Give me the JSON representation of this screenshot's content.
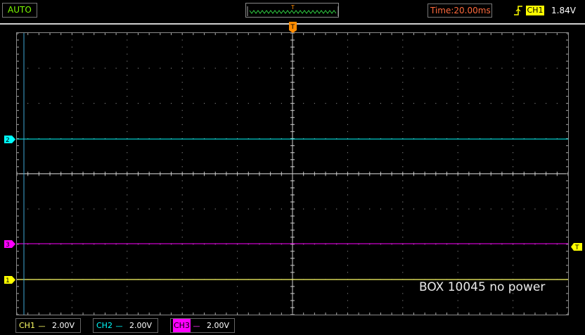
{
  "top_bar": {
    "mode": "AUTO",
    "trigger_position_marker": "T",
    "timebase": "Time:20.00ms",
    "trigger": {
      "channel": "CH1",
      "level": "1.84V",
      "edge_icon": "rising-edge-icon"
    }
  },
  "screen": {
    "annotation": "BOX 10045 no power",
    "markers": {
      "ch2": "2",
      "ch3": "3",
      "ch1": "1",
      "trigger_level": "T",
      "trigger_position": "T"
    }
  },
  "channels": [
    {
      "name": "CH1",
      "coupling": "----",
      "scale": "2.00V",
      "color": "#ffff66"
    },
    {
      "name": "CH2",
      "coupling": "----",
      "scale": "2.00V",
      "color": "#00ffff"
    },
    {
      "name": "CH3",
      "coupling": "----",
      "scale": "2.00V",
      "color": "#ff00ff"
    }
  ],
  "colors": {
    "background": "#000000",
    "grid": "#aaaaaa",
    "trigger_marker": "#ff8c00",
    "trigger_level_marker": "#ffff00",
    "ch1": "#ffff66",
    "ch2": "#00ffff",
    "ch3": "#ff00ff",
    "timebase": "#ff6a3d",
    "mode": "#7cfc00"
  }
}
